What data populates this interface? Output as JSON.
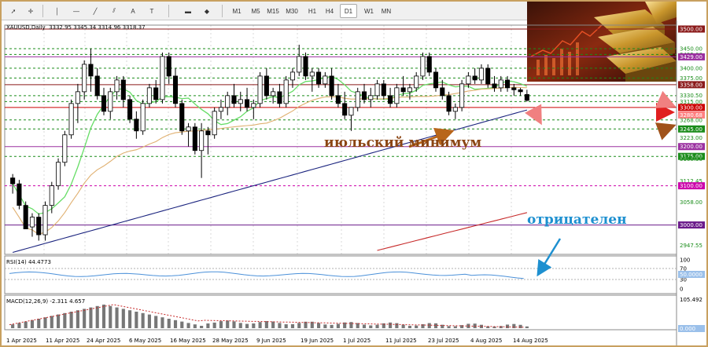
{
  "toolbar": {
    "tools": [
      "cursor-icon",
      "crosshair-icon",
      "vertical-line-icon",
      "horizontal-line-icon",
      "trendline-icon",
      "channel-icon",
      "text-icon",
      "label-icon",
      "rectangle-icon",
      "shapes-icon"
    ],
    "timeframes": [
      "M1",
      "M5",
      "M15",
      "M30",
      "H1",
      "H4",
      "D1",
      "W1",
      "MN"
    ],
    "active_timeframe": "D1"
  },
  "chart_header": {
    "symbol": "XAUUSD,Daily",
    "ohlc": "3332.95 3345.34 3314.96 3318.37"
  },
  "annotations": {
    "july_minimum": "июльский минимум",
    "negative": "отрицателен"
  },
  "price_axis": {
    "labels": [
      "3500.00",
      "3450.00",
      "3435.00",
      "3429.00",
      "3400.00",
      "3375.00",
      "3358.00",
      "3330.50",
      "3315.00",
      "3300.00",
      "3280.68",
      "3268.00",
      "3245.00",
      "3223.00",
      "3200.00",
      "3175.00",
      "3168.30",
      "3112.45",
      "3100.00",
      "3058.00",
      "3000.00",
      "2947.55"
    ],
    "highlight_tags": [
      {
        "text": "3500.00",
        "color": "#8b1a1a"
      },
      {
        "text": "3429.00",
        "color": "#9b30a0"
      },
      {
        "text": "3358.00",
        "color": "#8b1a1a"
      },
      {
        "text": "3300.00",
        "color": "#cc0000"
      },
      {
        "text": "3280.68",
        "color": "#ff8080"
      },
      {
        "text": "3245.00",
        "color": "#1a8c1a"
      },
      {
        "text": "3200.00",
        "color": "#9b30a0"
      },
      {
        "text": "3175.00",
        "color": "#1a8c1a"
      },
      {
        "text": "3100.00",
        "color": "#cc00aa"
      },
      {
        "text": "3000.00",
        "color": "#6a1a8a"
      }
    ]
  },
  "date_axis": {
    "labels": [
      "1 Apr 2025",
      "11 Apr 2025",
      "24 Apr 2025",
      "6 May 2025",
      "16 May 2025",
      "28 May 2025",
      "9 Jun 2025",
      "19 Jun 2025",
      "1 Jul 2025",
      "11 Jul 2025",
      "23 Jul 2025",
      "4 Aug 2025",
      "14 Aug 2025"
    ]
  },
  "rsi": {
    "header": "RSI(14) 44.4773",
    "levels": [
      "100",
      "70",
      "30",
      "0"
    ],
    "current_tag": "50.0000"
  },
  "macd": {
    "header": "MACD(12,26,9) -2.311 4.657",
    "axis_labels": [
      "105.492",
      "0.000"
    ]
  },
  "colors": {
    "bull": "#000000",
    "bear": "#000000",
    "ma_green": "#66dd66",
    "ma_tan": "#e0b070",
    "ma_navy": "#1a237e",
    "ma_red": "#c62828",
    "rsi_line": "#4a90d9",
    "annotation_brown": "#8b4513",
    "annotation_blue": "#1e90d0"
  },
  "chart_data": {
    "type": "candlestick",
    "symbol": "XAUUSD",
    "timeframe": "Daily",
    "ylim": [
      2925,
      3510
    ],
    "candles": [
      [
        3120,
        3130,
        3080,
        3105
      ],
      [
        3105,
        3115,
        3040,
        3050
      ],
      [
        3050,
        3060,
        3000,
        2990
      ],
      [
        2995,
        3030,
        2970,
        3020
      ],
      [
        3020,
        3030,
        2960,
        2975
      ],
      [
        2975,
        3060,
        2960,
        3050
      ],
      [
        3050,
        3110,
        3030,
        3100
      ],
      [
        3100,
        3170,
        3090,
        3160
      ],
      [
        3160,
        3240,
        3150,
        3230
      ],
      [
        3230,
        3320,
        3220,
        3310
      ],
      [
        3310,
        3360,
        3260,
        3340
      ],
      [
        3340,
        3420,
        3320,
        3410
      ],
      [
        3410,
        3450,
        3340,
        3380
      ],
      [
        3380,
        3400,
        3320,
        3330
      ],
      [
        3330,
        3350,
        3280,
        3290
      ],
      [
        3290,
        3350,
        3270,
        3340
      ],
      [
        3340,
        3380,
        3320,
        3370
      ],
      [
        3370,
        3380,
        3300,
        3320
      ],
      [
        3320,
        3330,
        3260,
        3270
      ],
      [
        3270,
        3290,
        3220,
        3240
      ],
      [
        3240,
        3320,
        3230,
        3310
      ],
      [
        3310,
        3360,
        3300,
        3350
      ],
      [
        3350,
        3370,
        3310,
        3320
      ],
      [
        3320,
        3440,
        3310,
        3430
      ],
      [
        3430,
        3440,
        3360,
        3380
      ],
      [
        3380,
        3400,
        3300,
        3310
      ],
      [
        3310,
        3320,
        3230,
        3240
      ],
      [
        3240,
        3260,
        3200,
        3250
      ],
      [
        3250,
        3260,
        3180,
        3190
      ],
      [
        3190,
        3260,
        3120,
        3240
      ],
      [
        3240,
        3250,
        3180,
        3230
      ],
      [
        3230,
        3300,
        3220,
        3290
      ],
      [
        3290,
        3320,
        3270,
        3300
      ],
      [
        3300,
        3340,
        3280,
        3330
      ],
      [
        3330,
        3360,
        3300,
        3310
      ],
      [
        3310,
        3340,
        3290,
        3320
      ],
      [
        3320,
        3350,
        3290,
        3300
      ],
      [
        3300,
        3320,
        3270,
        3310
      ],
      [
        3310,
        3390,
        3300,
        3380
      ],
      [
        3380,
        3400,
        3320,
        3330
      ],
      [
        3330,
        3350,
        3310,
        3340
      ],
      [
        3340,
        3360,
        3300,
        3310
      ],
      [
        3310,
        3380,
        3300,
        3370
      ],
      [
        3370,
        3400,
        3350,
        3390
      ],
      [
        3390,
        3460,
        3380,
        3430
      ],
      [
        3430,
        3440,
        3370,
        3380
      ],
      [
        3380,
        3400,
        3340,
        3390
      ],
      [
        3390,
        3400,
        3350,
        3360
      ],
      [
        3360,
        3390,
        3350,
        3380
      ],
      [
        3380,
        3400,
        3320,
        3330
      ],
      [
        3330,
        3360,
        3300,
        3310
      ],
      [
        3310,
        3340,
        3270,
        3280
      ],
      [
        3280,
        3300,
        3240,
        3300
      ],
      [
        3300,
        3350,
        3290,
        3340
      ],
      [
        3340,
        3360,
        3310,
        3320
      ],
      [
        3320,
        3350,
        3300,
        3330
      ],
      [
        3330,
        3370,
        3320,
        3360
      ],
      [
        3360,
        3370,
        3320,
        3330
      ],
      [
        3330,
        3350,
        3300,
        3310
      ],
      [
        3310,
        3360,
        3300,
        3350
      ],
      [
        3350,
        3380,
        3330,
        3340
      ],
      [
        3340,
        3360,
        3320,
        3350
      ],
      [
        3350,
        3390,
        3340,
        3380
      ],
      [
        3380,
        3440,
        3370,
        3430
      ],
      [
        3430,
        3440,
        3380,
        3390
      ],
      [
        3390,
        3400,
        3340,
        3350
      ],
      [
        3350,
        3370,
        3320,
        3330
      ],
      [
        3330,
        3340,
        3280,
        3290
      ],
      [
        3290,
        3310,
        3270,
        3300
      ],
      [
        3300,
        3370,
        3290,
        3360
      ],
      [
        3360,
        3390,
        3350,
        3380
      ],
      [
        3380,
        3400,
        3360,
        3370
      ],
      [
        3370,
        3410,
        3360,
        3400
      ],
      [
        3400,
        3410,
        3350,
        3360
      ],
      [
        3360,
        3380,
        3340,
        3350
      ],
      [
        3350,
        3380,
        3340,
        3370
      ],
      [
        3370,
        3380,
        3340,
        3350
      ],
      [
        3350,
        3360,
        3330,
        3345
      ],
      [
        3345,
        3350,
        3330,
        3340
      ],
      [
        3333,
        3345,
        3315,
        3318
      ]
    ]
  }
}
